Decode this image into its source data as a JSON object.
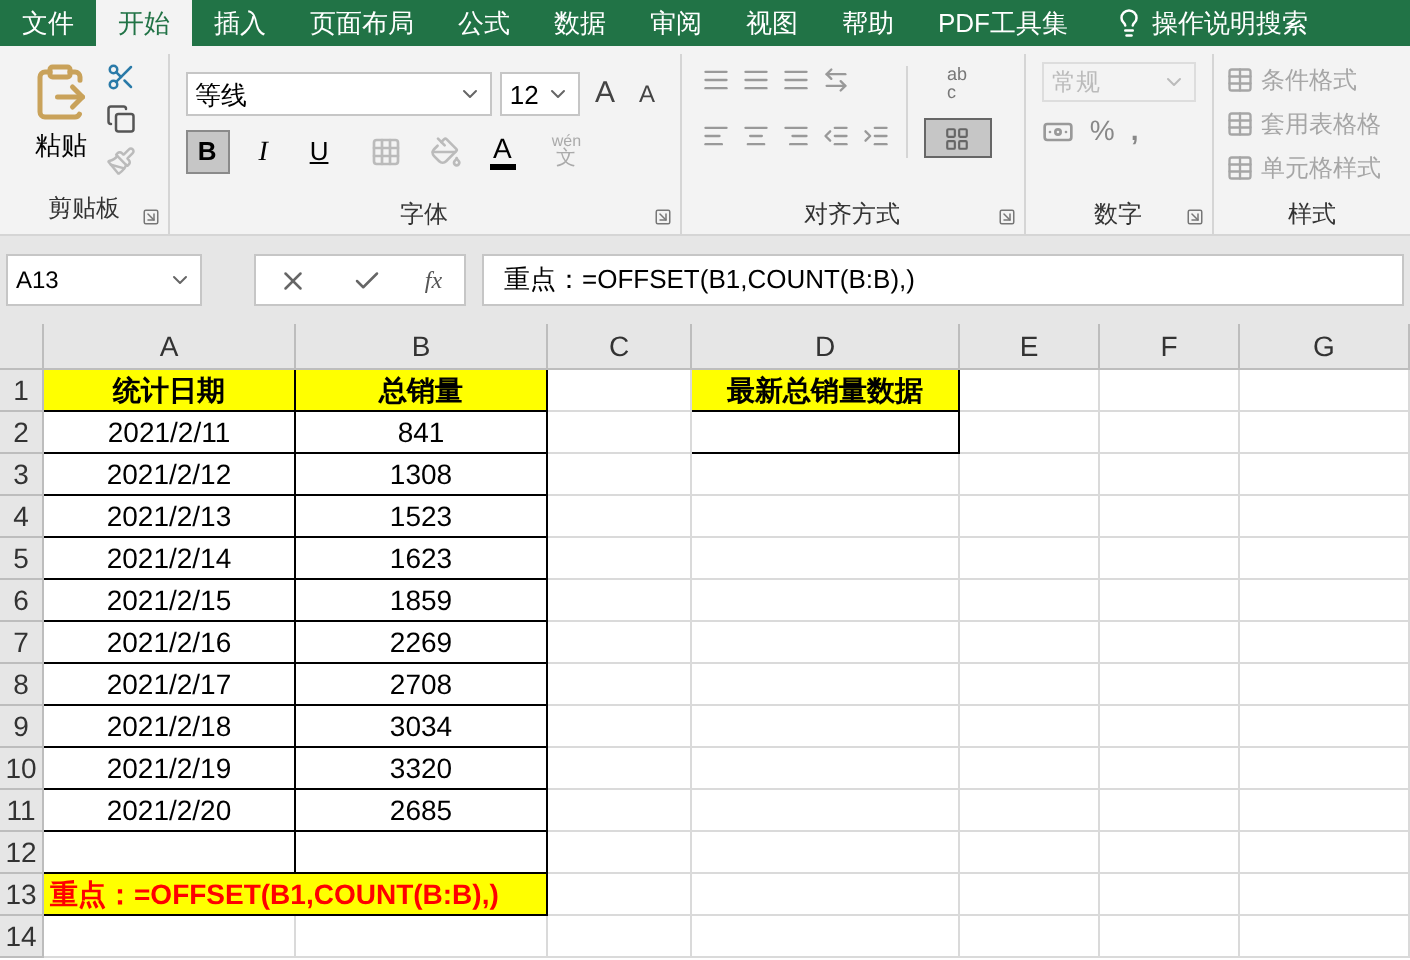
{
  "tabs": [
    {
      "label": "文件",
      "selected": false
    },
    {
      "label": "开始",
      "selected": true
    },
    {
      "label": "插入",
      "selected": false
    },
    {
      "label": "页面布局",
      "selected": false
    },
    {
      "label": "公式",
      "selected": false
    },
    {
      "label": "数据",
      "selected": false
    },
    {
      "label": "审阅",
      "selected": false
    },
    {
      "label": "视图",
      "selected": false
    },
    {
      "label": "帮助",
      "selected": false
    },
    {
      "label": "PDF工具集",
      "selected": false
    }
  ],
  "tell_me": "操作说明搜索",
  "ribbon": {
    "clipboard": {
      "paste": "粘贴",
      "label": "剪贴板"
    },
    "font": {
      "name": "等线",
      "size": "12",
      "grow": "A",
      "shrink": "A",
      "bold": {
        "label": "B",
        "pressed": true
      },
      "italic": {
        "label": "I",
        "pressed": false
      },
      "underline": {
        "label": "U",
        "pressed": false
      },
      "font_color": "A",
      "phonetic_top": "wén",
      "phonetic_bottom": "文",
      "label": "字体"
    },
    "alignment": {
      "wrap_top": "ab",
      "wrap_bottom": "c",
      "merge_pressed": true,
      "label": "对齐方式"
    },
    "number": {
      "format": "常规",
      "format_disabled": true,
      "percent": "%",
      "comma": ",",
      "label": "数字"
    },
    "styles": {
      "items": [
        {
          "label": "条件格式",
          "disabled": true
        },
        {
          "label": "套用表格格",
          "disabled": true
        },
        {
          "label": "单元格样式",
          "disabled": true
        }
      ],
      "label": "样式"
    }
  },
  "name_box": "A13",
  "insert_function": "fx",
  "formula": "重点：=OFFSET(B1,COUNT(B:B),)",
  "columns": [
    "A",
    "B",
    "C",
    "D",
    "E",
    "F",
    "G"
  ],
  "rows": [
    {
      "num": "1",
      "cells": [
        {
          "text": "统计日期",
          "kind": "header",
          "bordered": true
        },
        {
          "text": "总销量",
          "kind": "header",
          "bordered": true
        },
        null,
        {
          "text": "最新总销量数据",
          "kind": "header",
          "bordered": true
        },
        null,
        null,
        null
      ]
    },
    {
      "num": "2",
      "cells": [
        {
          "text": "2021/2/11",
          "bordered": true
        },
        {
          "text": "841",
          "bordered": true
        },
        null,
        {
          "bordered": true
        },
        null,
        null,
        null
      ]
    },
    {
      "num": "3",
      "cells": [
        {
          "text": "2021/2/12",
          "bordered": true
        },
        {
          "text": "1308",
          "bordered": true
        },
        null,
        null,
        null,
        null,
        null
      ]
    },
    {
      "num": "4",
      "cells": [
        {
          "text": "2021/2/13",
          "bordered": true
        },
        {
          "text": "1523",
          "bordered": true
        },
        null,
        null,
        null,
        null,
        null
      ]
    },
    {
      "num": "5",
      "cells": [
        {
          "text": "2021/2/14",
          "bordered": true
        },
        {
          "text": "1623",
          "bordered": true
        },
        null,
        null,
        null,
        null,
        null
      ]
    },
    {
      "num": "6",
      "cells": [
        {
          "text": "2021/2/15",
          "bordered": true
        },
        {
          "text": "1859",
          "bordered": true
        },
        null,
        null,
        null,
        null,
        null
      ]
    },
    {
      "num": "7",
      "cells": [
        {
          "text": "2021/2/16",
          "bordered": true
        },
        {
          "text": "2269",
          "bordered": true
        },
        null,
        null,
        null,
        null,
        null
      ]
    },
    {
      "num": "8",
      "cells": [
        {
          "text": "2021/2/17",
          "bordered": true
        },
        {
          "text": "2708",
          "bordered": true
        },
        null,
        null,
        null,
        null,
        null
      ]
    },
    {
      "num": "9",
      "cells": [
        {
          "text": "2021/2/18",
          "bordered": true
        },
        {
          "text": "3034",
          "bordered": true
        },
        null,
        null,
        null,
        null,
        null
      ]
    },
    {
      "num": "10",
      "cells": [
        {
          "text": "2021/2/19",
          "bordered": true
        },
        {
          "text": "3320",
          "bordered": true
        },
        null,
        null,
        null,
        null,
        null
      ]
    },
    {
      "num": "11",
      "cells": [
        {
          "text": "2021/2/20",
          "bordered": true
        },
        {
          "text": "2685",
          "bordered": true
        },
        null,
        null,
        null,
        null,
        null
      ]
    },
    {
      "num": "12",
      "cells": [
        {
          "bordered": true
        },
        {
          "bordered": true
        },
        null,
        null,
        null,
        null,
        null
      ]
    },
    {
      "num": "13",
      "cells": [
        {
          "text": "重点：=OFFSET(B1,COUNT(B:B),)",
          "kind": "note",
          "bordered": true
        },
        null,
        null,
        null,
        null,
        null
      ]
    },
    {
      "num": "14",
      "cells": [
        null,
        null,
        null,
        null,
        null,
        null,
        null
      ]
    }
  ]
}
